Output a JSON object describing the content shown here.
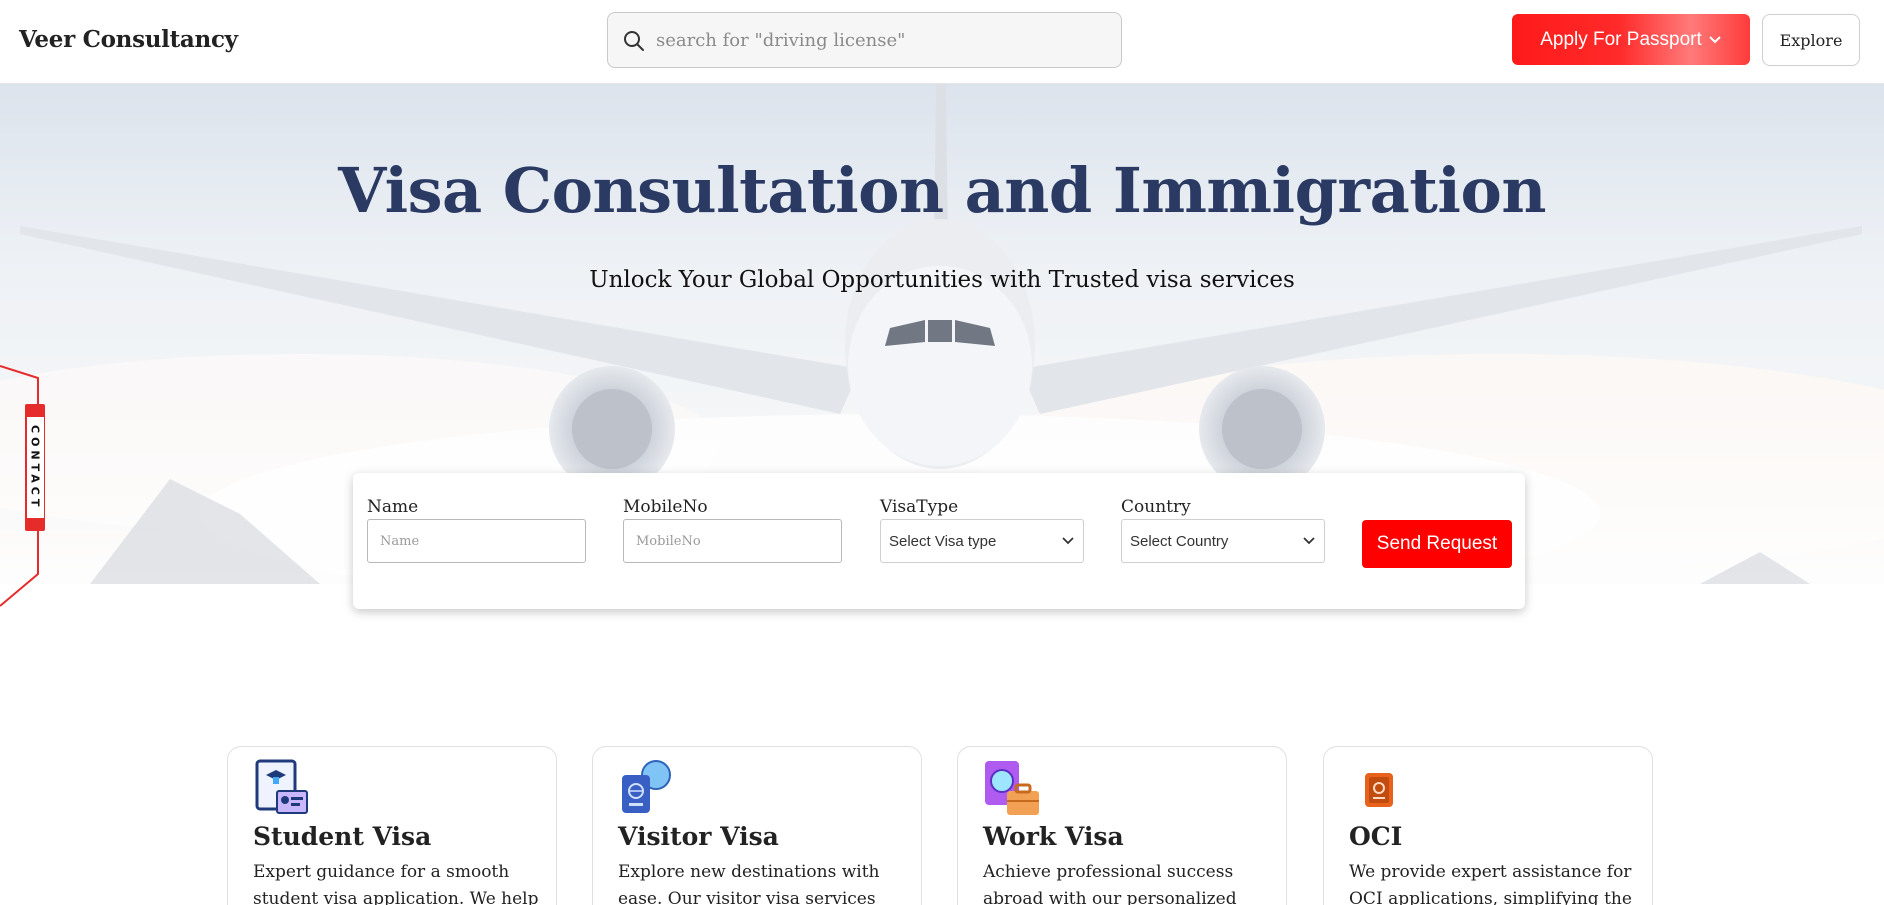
{
  "header": {
    "brand": "Veer Consultancy",
    "search_placeholder": "search for \"driving license\"",
    "apply_button": "Apply For Passport",
    "explore_button": "Explore"
  },
  "hero": {
    "title": "Visa Consultation and Immigration",
    "subtitle": "Unlock Your Global Opportunities with Trusted visa services"
  },
  "contact_tab": "CONTACT",
  "form": {
    "name_label": "Name",
    "name_placeholder": "Name",
    "mobile_label": "MobileNo",
    "mobile_placeholder": "MobileNo",
    "visatype_label": "VisaType",
    "visatype_selected": "Select Visa type",
    "country_label": "Country",
    "country_selected": "Select Country",
    "submit": "Send Request"
  },
  "services": [
    {
      "title": "Student Visa",
      "desc": "Expert guidance for a smooth student visa application. We help"
    },
    {
      "title": "Visitor Visa",
      "desc": "Explore new destinations with ease. Our visitor visa services"
    },
    {
      "title": "Work Visa",
      "desc": "Achieve professional success abroad with our personalized work"
    },
    {
      "title": "OCI",
      "desc": "We provide expert assistance for OCI applications, simplifying the"
    }
  ],
  "colors": {
    "accent_red": "#ff0000",
    "title_navy": "#2a3a63"
  }
}
